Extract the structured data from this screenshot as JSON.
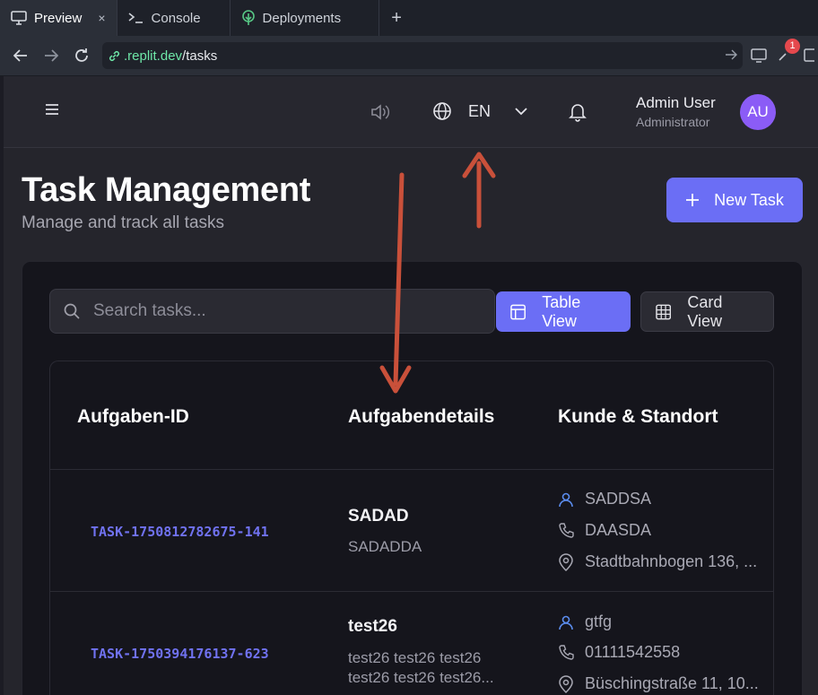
{
  "browser": {
    "tabs": [
      {
        "label": "Preview",
        "icon": "monitor-icon",
        "close": "×"
      },
      {
        "label": "Console",
        "icon": "terminal-icon"
      },
      {
        "label": "Deployments",
        "icon": "tree-icon"
      }
    ],
    "new_tab": "+",
    "url_domain": ".replit.dev",
    "url_path": "/tasks",
    "notification_count": "1"
  },
  "header": {
    "language_code": "EN",
    "user_name": "Admin User",
    "user_role": "Administrator",
    "avatar_initials": "AU"
  },
  "page": {
    "title": "Task Management",
    "subtitle": "Manage and track all tasks",
    "new_task_label": "New Task",
    "search_placeholder": "Search tasks...",
    "table_view_label": "Table View",
    "card_view_label": "Card View"
  },
  "table": {
    "columns": [
      "Aufgaben-ID",
      "Aufgabendetails",
      "Kunde & Standort"
    ],
    "rows": [
      {
        "id": "TASK-1750812782675-141",
        "title": "SADAD",
        "description": "SADADDA",
        "customer": "SADDSA",
        "phone": "DAASDA",
        "address": "Stadtbahnbogen 136, ..."
      },
      {
        "id": "TASK-1750394176137-623",
        "title": "test26",
        "description": "test26 test26 test26 test26 test26 test26...",
        "customer": "gtfg",
        "phone": "01111542558",
        "address": "Büschingstraße 11, 10..."
      }
    ]
  },
  "colors": {
    "accent": "#6b6ef5",
    "annotation_arrow": "#c9503a",
    "avatar": "#8b5cf6"
  }
}
